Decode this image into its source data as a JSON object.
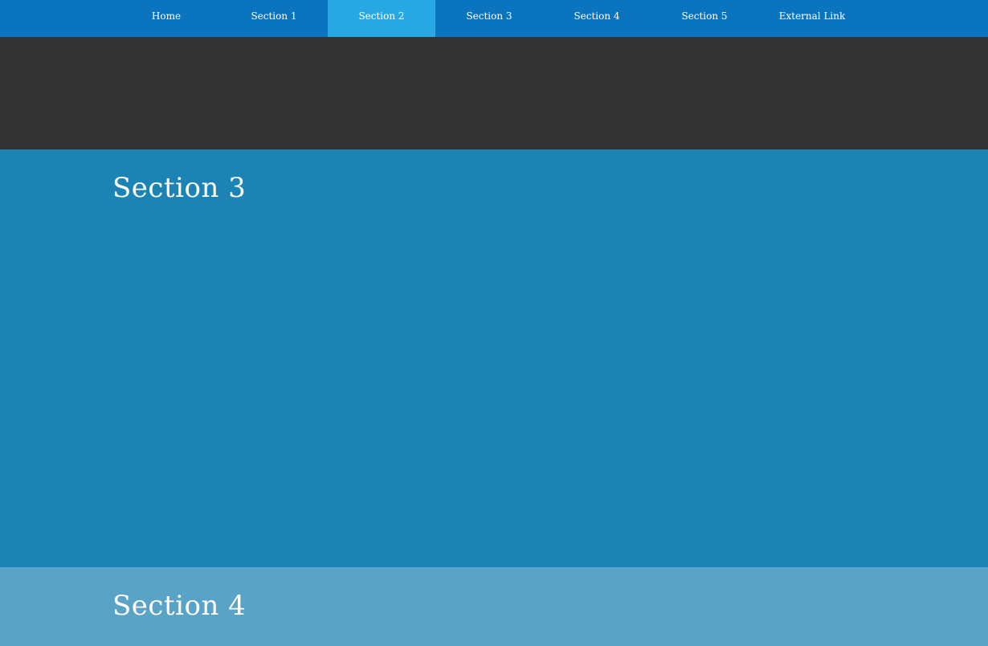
{
  "colors": {
    "navbar_background": "#0a74be",
    "nav_active_background": "#27a8e3",
    "hero_background": "#333333",
    "section3_background": "#1b84b5",
    "section4_background": "#59a3c6",
    "text": "#ffffff"
  },
  "nav": {
    "items": [
      {
        "label": "Home"
      },
      {
        "label": "Section 1"
      },
      {
        "label": "Section 2",
        "active": true
      },
      {
        "label": "Section 3"
      },
      {
        "label": "Section 4"
      },
      {
        "label": "Section 5"
      },
      {
        "label": "External Link"
      }
    ]
  },
  "sections": [
    {
      "title": "Section 3"
    },
    {
      "title": "Section 4"
    }
  ]
}
